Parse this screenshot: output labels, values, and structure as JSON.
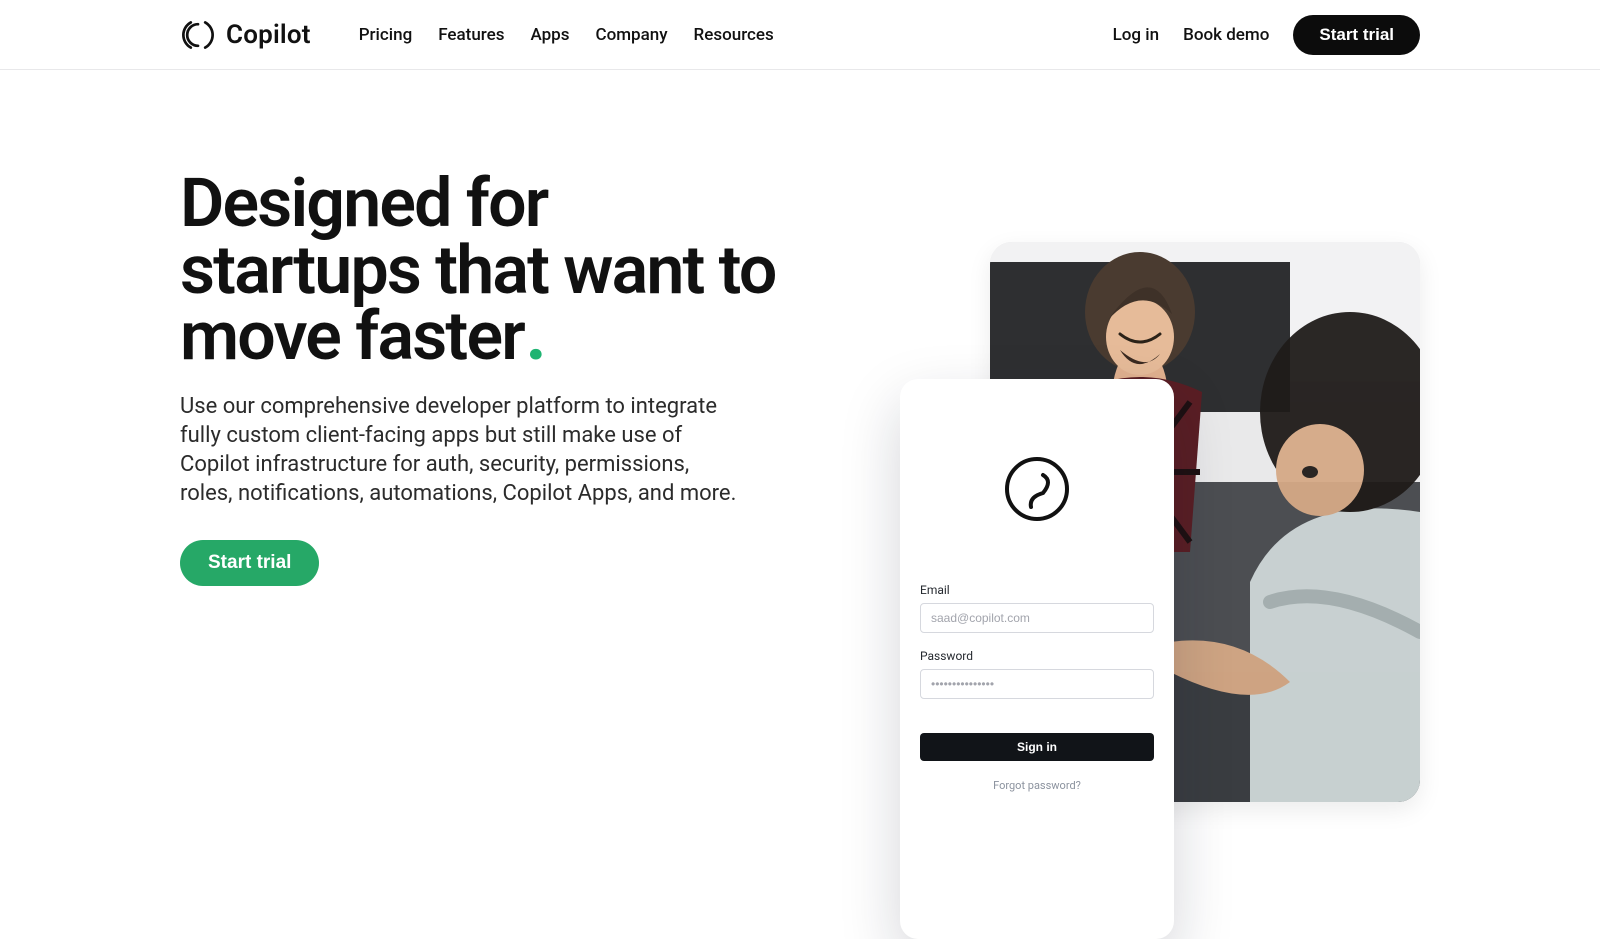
{
  "brand": {
    "name": "Copilot"
  },
  "nav": {
    "items": [
      {
        "label": "Pricing"
      },
      {
        "label": "Features"
      },
      {
        "label": "Apps"
      },
      {
        "label": "Company"
      },
      {
        "label": "Resources"
      }
    ],
    "login": "Log in",
    "demo": "Book demo",
    "start_trial": "Start trial"
  },
  "hero": {
    "headline": "Designed for startups that want to move faster",
    "accent": ".",
    "subcopy": "Use our comprehensive developer platform to integrate fully custom client-facing apps but still make use of Copilot infrastructure for auth, security, permissions, roles, notifications, automations, Copilot Apps, and more.",
    "cta": "Start trial"
  },
  "login": {
    "email_label": "Email",
    "email_placeholder": "saad@copilot.com",
    "password_label": "Password",
    "password_placeholder": "•••••••••••••••",
    "submit": "Sign in",
    "forgot": "Forgot password?"
  },
  "colors": {
    "cta_green": "#26a867",
    "accent_green": "#1fb472",
    "primary_black": "#0c0c0c"
  }
}
